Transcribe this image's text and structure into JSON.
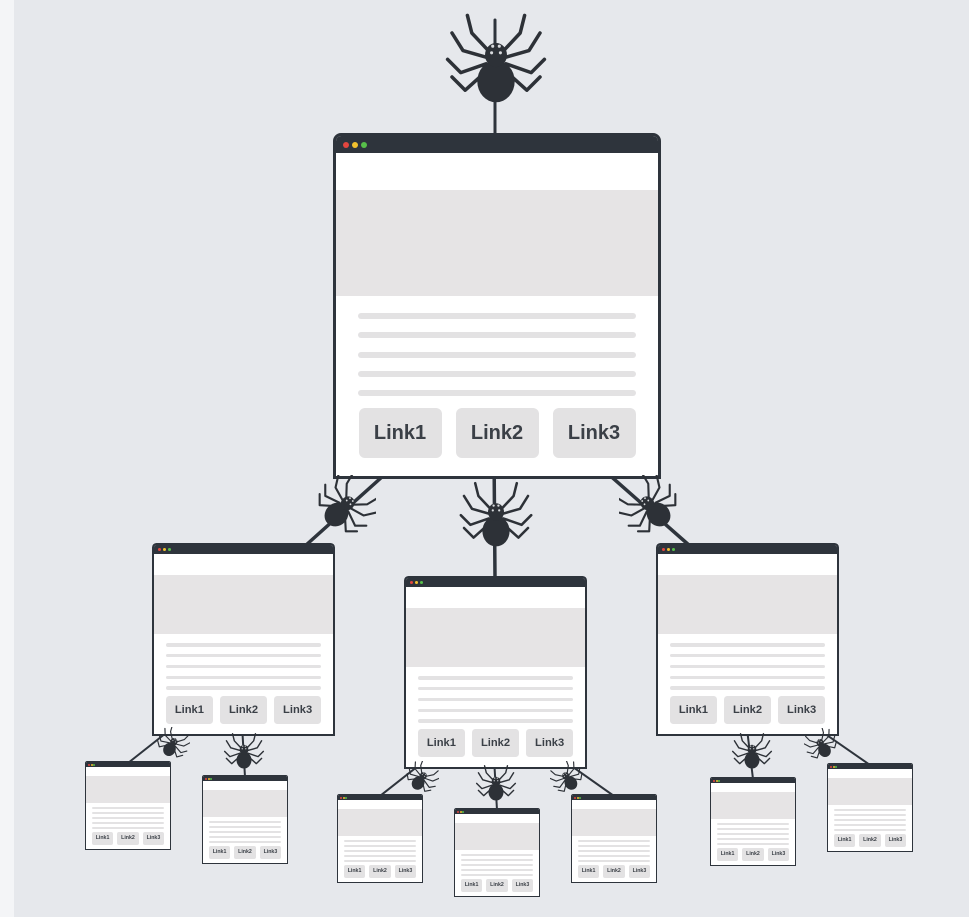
{
  "diagram": {
    "links": [
      "Link1",
      "Link2",
      "Link3"
    ]
  },
  "colors": {
    "background": "#e6e8ec",
    "frame": "#2e343c",
    "spider": "#2d3137",
    "placeholder": "#e3e2e3",
    "dot_red": "#e2463f",
    "dot_yellow": "#f2c12e",
    "dot_green": "#57c04a"
  },
  "icons": [
    "spider-icon",
    "browser-window-icon"
  ]
}
